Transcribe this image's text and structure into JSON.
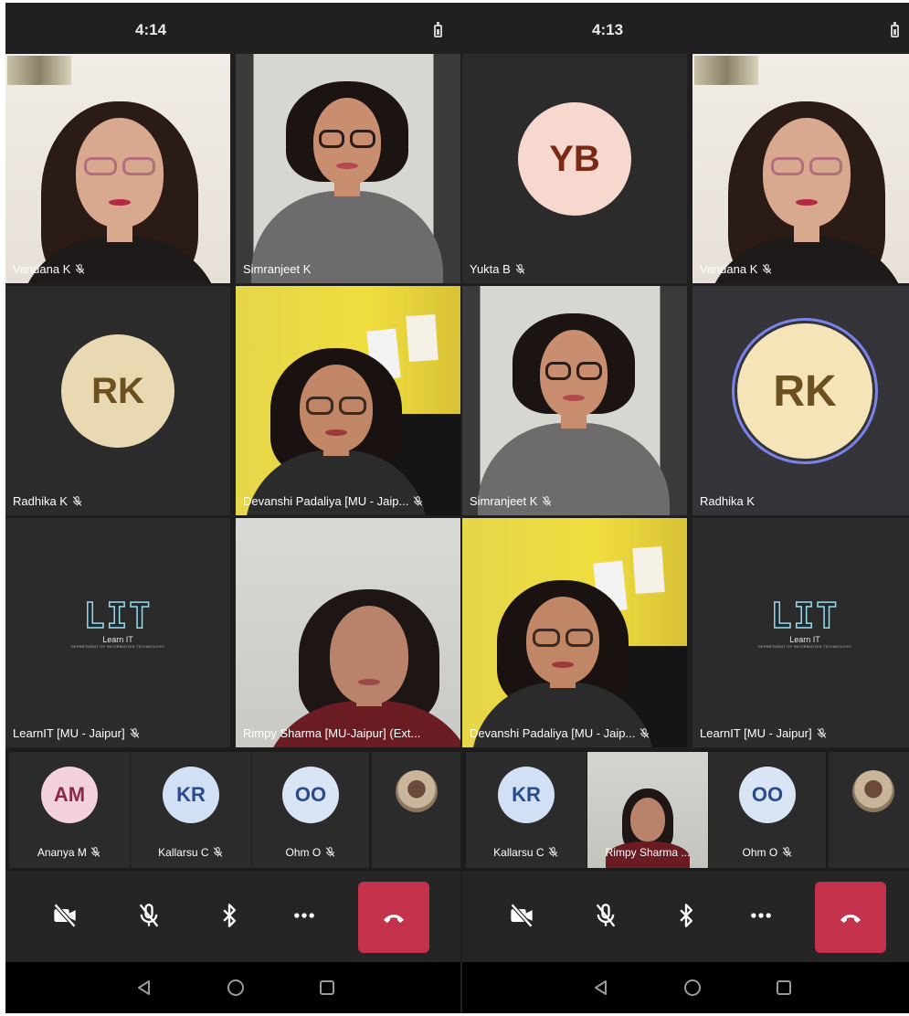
{
  "phones": [
    {
      "time": "4:14",
      "tiles": [
        {
          "name": "Vandana K",
          "muted": true,
          "kind": "video-vandana",
          "active": false
        },
        {
          "name": "Simranjeet K",
          "muted": false,
          "kind": "video-simran",
          "active": true
        },
        {
          "name": "Radhika K",
          "muted": true,
          "kind": "avatar",
          "initials": "RK",
          "avatar_bg": "#e9d9b3",
          "avatar_fg": "#6b5020",
          "active": false
        },
        {
          "name": "Devanshi Padaliya [MU - Jaip...",
          "muted": true,
          "kind": "video-devanshi",
          "active": false
        },
        {
          "name": "LearnIT [MU - Jaipur]",
          "muted": true,
          "kind": "logo",
          "active": false
        },
        {
          "name": "Rimpy Sharma [MU-Jaipur] (Ext...",
          "muted": false,
          "kind": "video-rimpy",
          "active": false
        }
      ],
      "strip": [
        {
          "name": "Ananya M",
          "muted": true,
          "kind": "avatar",
          "initials": "AM",
          "avatar_bg": "#f3d2dc",
          "avatar_fg": "#8a2a4a"
        },
        {
          "name": "Kallarsu C",
          "muted": true,
          "kind": "avatar",
          "initials": "KR",
          "avatar_bg": "#d2e0f5",
          "avatar_fg": "#2a4a8a"
        },
        {
          "name": "Ohm O",
          "muted": true,
          "kind": "avatar",
          "initials": "OO",
          "avatar_bg": "#d9e5f5",
          "avatar_fg": "#2a4a8a"
        },
        {
          "name": "",
          "muted": false,
          "kind": "photo"
        }
      ]
    },
    {
      "time": "4:13",
      "tiles": [
        {
          "name": "Yukta B",
          "muted": true,
          "kind": "avatar",
          "initials": "YB",
          "avatar_bg": "#f7d8cf",
          "avatar_fg": "#7a2a14",
          "active": false
        },
        {
          "name": "Vandana K",
          "muted": true,
          "kind": "video-vandana",
          "active": false
        },
        {
          "name": "Simranjeet K",
          "muted": true,
          "kind": "video-simran",
          "active": false
        },
        {
          "name": "Radhika K",
          "muted": false,
          "kind": "avatar",
          "initials": "RK",
          "avatar_bg": "#f5e4b8",
          "avatar_fg": "#6b5020",
          "active": false,
          "ring": true
        },
        {
          "name": "Devanshi Padaliya [MU - Jaip...",
          "muted": true,
          "kind": "video-devanshi",
          "active": false
        },
        {
          "name": "LearnIT [MU - Jaipur]",
          "muted": true,
          "kind": "logo",
          "active": false
        }
      ],
      "strip": [
        {
          "name": "Kallarsu C",
          "muted": true,
          "kind": "avatar",
          "initials": "KR",
          "avatar_bg": "#d2e0f5",
          "avatar_fg": "#2a4a8a"
        },
        {
          "name": "Rimpy Sharma ...",
          "muted": false,
          "kind": "video-small"
        },
        {
          "name": "Ohm O",
          "muted": true,
          "kind": "avatar",
          "initials": "OO",
          "avatar_bg": "#d9e5f5",
          "avatar_fg": "#2a4a8a"
        },
        {
          "name": "",
          "muted": false,
          "kind": "photo"
        }
      ]
    }
  ],
  "logo": {
    "big": "LIT",
    "sub": "Learn IT",
    "sub2": "DEPARTMENT OF INFORMATION TECHNOLOGY"
  },
  "controls": [
    "camera-off-icon",
    "mic-off-icon",
    "bluetooth-icon",
    "more-icon",
    "hang-up-icon"
  ],
  "colors": {
    "hangup": "#c4314b",
    "active_border": "#7b83eb",
    "tile_bg": "#2b2b2b",
    "background": "#1f1f1f"
  }
}
